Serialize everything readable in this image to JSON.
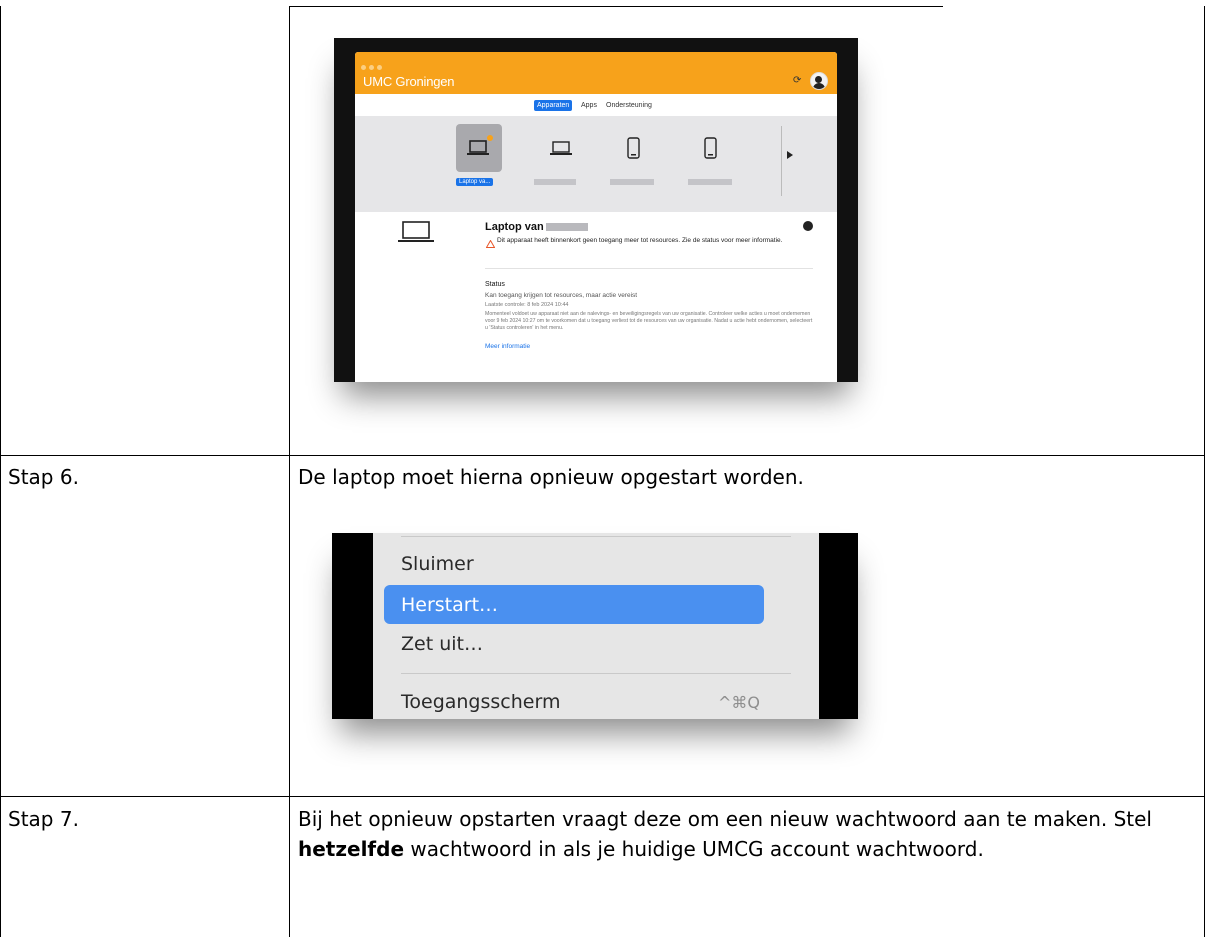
{
  "rows": [
    {
      "step": "",
      "text": ""
    },
    {
      "step": "Stap 6.",
      "text": "De laptop moet hierna opnieuw opgestart worden."
    },
    {
      "step": "Stap 7.",
      "text_before": "Bij het opnieuw opstarten vraagt deze om een nieuw wachtwoord aan te maken. Stel ",
      "text_bold": "hetzelfde",
      "text_after": " wachtwoord in als je huidige UMCG account wachtwoord."
    }
  ],
  "screenshot1": {
    "app_title": "UMC Groningen",
    "tabs": [
      {
        "label": "Apparaten",
        "active": true
      },
      {
        "label": "Apps",
        "active": false
      },
      {
        "label": "Ondersteuning",
        "active": false
      }
    ],
    "device_label": "Laptop va...",
    "detail_title": "Laptop van",
    "warning": "Dit apparaat heeft binnenkort geen toegang meer tot resources. Zie de status voor meer informatie.",
    "status_heading": "Status",
    "status_subheading": "Kan toegang krijgen tot resources, maar actie vereist",
    "last_check": "Laatste controle: 8 feb 2024 10:44",
    "status_body": "Momenteel voldoet uw apparaat niet aan de nalevings- en beveiligingsregels van uw organisatie. Controleer welke acties u moet ondernemen voor 9 feb 2024 10:27 om te voorkomen dat u toegang verliest tot de resources van uw organisatie. Nadat u actie hebt ondernomen, selecteert u 'Status controleren' in het menu.",
    "more_info_link": "Meer informatie",
    "colors": {
      "titlebar": "#f7a21b",
      "accent": "#1a73e8"
    }
  },
  "screenshot2": {
    "menu_items": [
      "Sluimer",
      "Herstart…",
      "Zet uit…",
      "Toegangsscherm"
    ],
    "highlighted_item": "Herstart…",
    "shortcut": "^⌘Q",
    "colors": {
      "highlight": "#4a90f0"
    }
  }
}
